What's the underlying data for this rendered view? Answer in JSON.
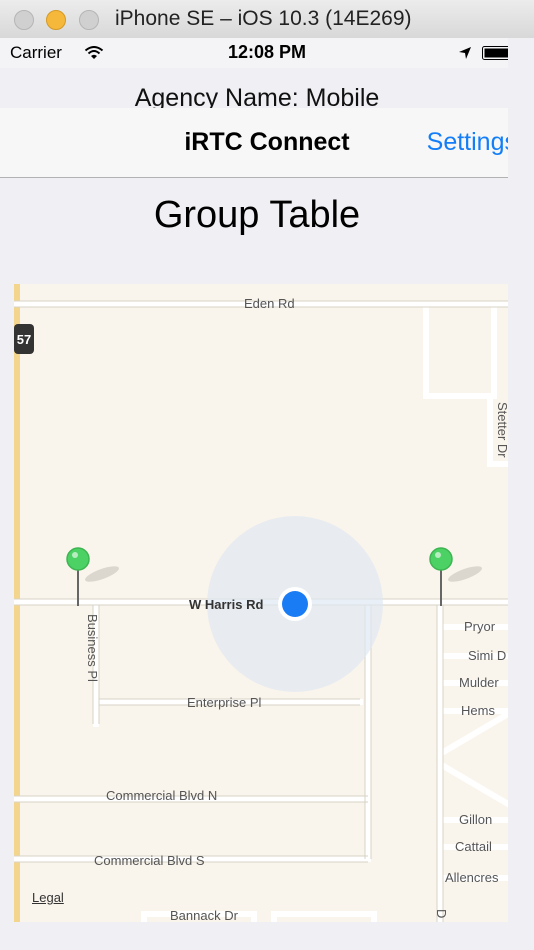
{
  "window": {
    "title": "iPhone SE – iOS 10.3 (14E269)"
  },
  "statusbar": {
    "carrier": "Carrier",
    "time": "12:08 PM"
  },
  "header": {
    "agency": "Agency Name: Mobile"
  },
  "navbar": {
    "title": "iRTC Connect",
    "settings_label": "Settings"
  },
  "page": {
    "heading": "Group Table"
  },
  "map": {
    "legal": "Legal",
    "highway_shield": "57",
    "streets": {
      "eden": "Eden Rd",
      "harris": "W Harris Rd",
      "business": "Business Pl",
      "enterprise": "Enterprise Pl",
      "commercial_n": "Commercial Blvd N",
      "commercial_s": "Commercial Blvd S",
      "bannack": "Bannack Dr",
      "stetter": "Stetter Dr",
      "pryor": "Pryor",
      "simi": "Simi D",
      "mulder": "Mulder",
      "hems": "Hems",
      "gillon": "Gillon",
      "cattail": "Cattail",
      "allencrest": "Allencres",
      "d": "D"
    },
    "pins": [
      {
        "name": "pin-left"
      },
      {
        "name": "pin-right"
      }
    ],
    "colors": {
      "pin": "#4cd264",
      "user_location": "#1a7cf5",
      "background": "#faf5ec"
    }
  }
}
